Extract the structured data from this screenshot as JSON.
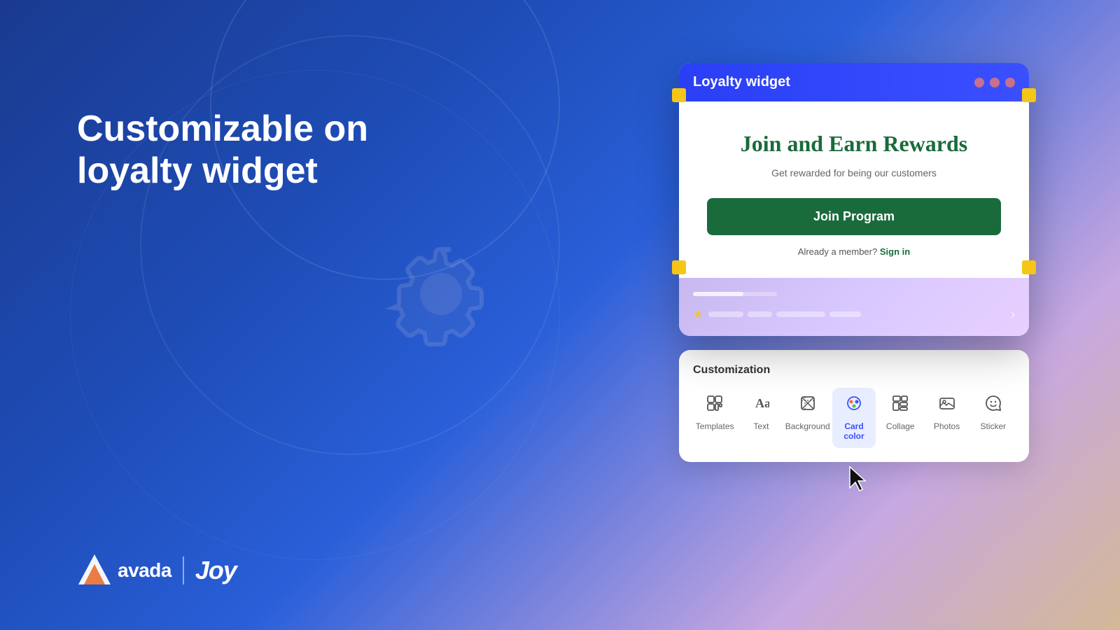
{
  "page": {
    "background_gradient": "linear-gradient(135deg, #1a3a8f, #1e4db7, #c8a8e0, #d4b896)"
  },
  "main_title": {
    "line1": "Customizable on",
    "line2": "loyalty widget"
  },
  "logo": {
    "avada_text": "avada",
    "divider": "|",
    "joy_text": "Joy"
  },
  "loyalty_window": {
    "title": "Loyalty widget",
    "window_dots": [
      "#e87070",
      "#f5c518",
      "#50c050"
    ],
    "rewards_title": "Join and Earn Rewards",
    "rewards_subtitle": "Get rewarded for being our customers",
    "join_button_label": "Join Program",
    "member_text": "Already a member?",
    "sign_in_text": "Sign in"
  },
  "customization_panel": {
    "title": "Customization",
    "tools": [
      {
        "id": "templates",
        "label": "Templates",
        "icon": "templates",
        "active": false
      },
      {
        "id": "text",
        "label": "Text",
        "icon": "text",
        "active": false
      },
      {
        "id": "background",
        "label": "Background",
        "icon": "background",
        "active": false
      },
      {
        "id": "card-color",
        "label": "Card color",
        "icon": "card-color",
        "active": true
      },
      {
        "id": "collage",
        "label": "Collage",
        "icon": "collage",
        "active": false
      },
      {
        "id": "photos",
        "label": "Photos",
        "icon": "photos",
        "active": false
      },
      {
        "id": "sticker",
        "label": "Sticker",
        "icon": "sticker",
        "active": false
      }
    ]
  }
}
